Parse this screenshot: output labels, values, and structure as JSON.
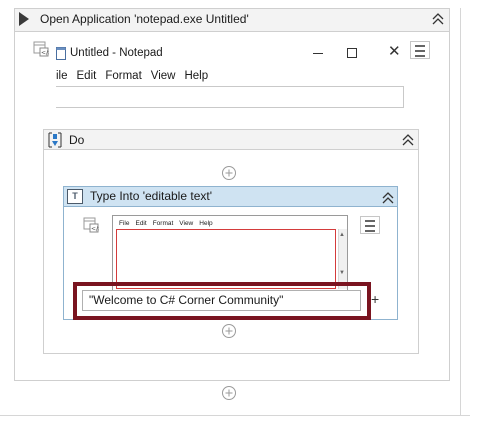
{
  "outer_activity": {
    "title": "Open Application 'notepad.exe Untitled'"
  },
  "notepad": {
    "title": "Untitled - Notepad",
    "close_glyph": "✕",
    "menu": [
      "ile",
      "Edit",
      "Format",
      "View",
      "Help"
    ]
  },
  "do_sequence": {
    "title": "Do"
  },
  "type_into": {
    "title": "Type Into 'editable text'",
    "thumbnail_menu": [
      "File",
      "Edit",
      "Format",
      "View",
      "Help"
    ],
    "text_value": "\"Welcome to C# Corner Community\"",
    "add_glyph": "+"
  },
  "colors": {
    "highlight": "#7a1420",
    "type_into_header": "#cfe3f2",
    "selection_red": "#d43b3b"
  },
  "icons": {
    "play": "play-icon",
    "collapse": "double-chevron-up-icon",
    "add": "plus-circle-icon",
    "indicate": "indicate-on-screen-icon",
    "menu": "hamburger-menu-icon"
  }
}
